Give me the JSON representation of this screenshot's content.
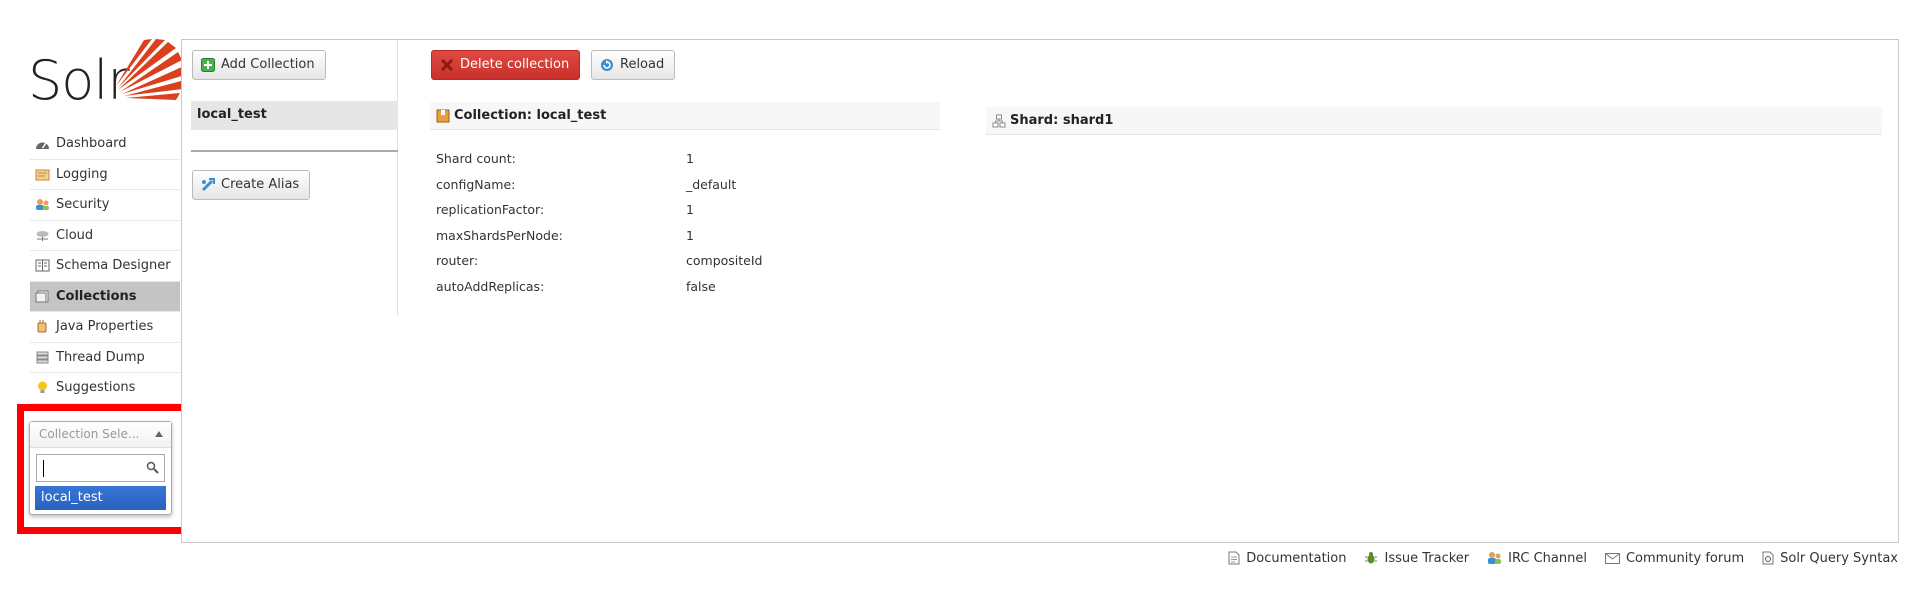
{
  "logo": {
    "text": "Solr"
  },
  "nav": {
    "items": [
      {
        "label": "Dashboard",
        "icon": "dashboard-icon"
      },
      {
        "label": "Logging",
        "icon": "logging-icon"
      },
      {
        "label": "Security",
        "icon": "security-icon"
      },
      {
        "label": "Cloud",
        "icon": "cloud-icon"
      },
      {
        "label": "Schema Designer",
        "icon": "schema-designer-icon"
      },
      {
        "label": "Collections",
        "icon": "collections-icon",
        "active": true
      },
      {
        "label": "Java Properties",
        "icon": "java-properties-icon"
      },
      {
        "label": "Thread Dump",
        "icon": "thread-dump-icon"
      },
      {
        "label": "Suggestions",
        "icon": "suggestions-icon"
      }
    ]
  },
  "collection_selector": {
    "placeholder": "Collection Sele...",
    "search_value": "",
    "options": [
      "local_test"
    ],
    "highlighted_option": "local_test"
  },
  "sidebar_list": {
    "add_collection_label": "Add Collection",
    "collections": [
      "local_test"
    ],
    "create_alias_label": "Create Alias"
  },
  "actions": {
    "delete_label": "Delete collection",
    "reload_label": "Reload"
  },
  "collection": {
    "header": "Collection: local_test",
    "properties": [
      {
        "key": "Shard count:",
        "value": "1"
      },
      {
        "key": "configName:",
        "value": "_default"
      },
      {
        "key": "replicationFactor:",
        "value": "1"
      },
      {
        "key": "maxShardsPerNode:",
        "value": "1"
      },
      {
        "key": "router:",
        "value": "compositeId"
      },
      {
        "key": "autoAddReplicas:",
        "value": "false"
      }
    ]
  },
  "shard": {
    "header": "Shard: shard1"
  },
  "footer": {
    "links": [
      {
        "label": "Documentation",
        "icon": "document-icon"
      },
      {
        "label": "Issue Tracker",
        "icon": "bug-icon"
      },
      {
        "label": "IRC Channel",
        "icon": "users-icon"
      },
      {
        "label": "Community forum",
        "icon": "mail-icon"
      },
      {
        "label": "Solr Query Syntax",
        "icon": "query-syntax-icon"
      }
    ]
  },
  "colors": {
    "accent": "#3875d7",
    "danger": "#d9534f",
    "active_nav": "#c4c4c4",
    "highlight_box": "#ff0000",
    "logo_sun": "#d9411e"
  }
}
